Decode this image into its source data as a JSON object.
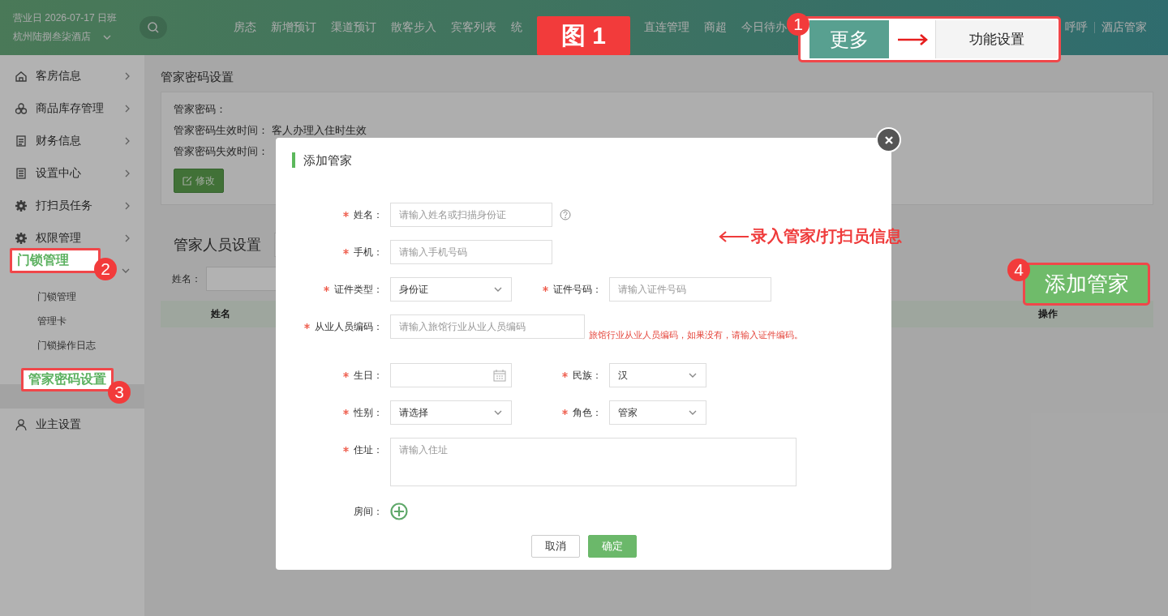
{
  "header": {
    "business_day": "营业日 2026-07-17 日班",
    "hotel": "杭州陆捌叁柒酒店",
    "nav": [
      [
        "房态",
        "新增预订",
        "渠道预订",
        "散客步入",
        "宾客列表",
        "统"
      ],
      [
        "直连管理",
        "商超",
        "今日待办"
      ]
    ],
    "right_links": [
      "呼呼",
      "酒店管家"
    ]
  },
  "sidebar": [
    {
      "label": "客房信息",
      "kind": "group",
      "expanded": false
    },
    {
      "label": "商品库存管理",
      "kind": "group",
      "expanded": false
    },
    {
      "label": "财务信息",
      "kind": "group",
      "expanded": false
    },
    {
      "label": "设置中心",
      "kind": "group",
      "expanded": false
    },
    {
      "label": "打扫员任务",
      "kind": "group",
      "expanded": false
    },
    {
      "label": "权限管理",
      "kind": "group",
      "expanded": false
    },
    {
      "kind": "group",
      "expanded": true,
      "children": [
        {
          "label": "门锁管理",
          "selected": false
        },
        {
          "label": "管理卡",
          "selected": false
        },
        {
          "label": "门锁操作日志",
          "selected": false
        },
        {
          "selected": true
        }
      ]
    },
    {
      "label": "业主设置",
      "kind": "link"
    }
  ],
  "password_panel": {
    "title": "管家密码设置",
    "fields": [
      {
        "label": "管家密码："
      },
      {
        "label": "管家密码生效时间：",
        "value": "客人办理入住时生效"
      },
      {
        "label": "管家密码失效时间："
      }
    ],
    "edit_button": "修改"
  },
  "staff": {
    "title": "管家人员设置",
    "filter_label": "姓名：",
    "columns": [
      "姓名",
      "操作"
    ]
  },
  "dialog": {
    "title": "添加管家",
    "rows": [
      [
        {
          "kind": "input",
          "label": "姓名：",
          "required": true,
          "placeholder": "请输入姓名或扫描身份证",
          "help": true
        }
      ],
      [
        {
          "kind": "input",
          "label": "手机：",
          "required": true,
          "placeholder": "请输入手机号码"
        }
      ],
      [
        {
          "kind": "select",
          "label": "证件类型：",
          "required": true,
          "value": "身份证"
        },
        {
          "kind": "input",
          "label": "证件号码：",
          "required": true,
          "placeholder": "请输入证件号码"
        }
      ],
      [
        {
          "kind": "input",
          "label": "从业人员编码：",
          "required": true,
          "placeholder": "请输入旅馆行业从业人员编码",
          "hint": "旅馆行业从业人员编码，如果没有，请输入证件编码。"
        }
      ],
      [
        {
          "kind": "date",
          "label": "生日：",
          "required": true
        },
        {
          "kind": "select",
          "label": "民族：",
          "required": true,
          "value": "汉"
        }
      ],
      [
        {
          "kind": "select",
          "label": "性别：",
          "required": true,
          "value": "请选择"
        },
        {
          "kind": "select",
          "label": "角色：",
          "required": true,
          "value": "管家"
        }
      ],
      [
        {
          "kind": "textarea",
          "label": "住址：",
          "required": true,
          "placeholder": "请输入住址"
        }
      ],
      [
        {
          "kind": "add",
          "label": "房间：",
          "required": false
        }
      ]
    ],
    "buttons": [
      {
        "label": "取消",
        "kind": "secondary"
      },
      {
        "label": "确定",
        "kind": "primary"
      }
    ]
  },
  "annotations": {
    "figure_label": "图 1",
    "note": "录入管家/打扫员信息",
    "steps": [
      {
        "number": "1",
        "kind": "menu-path",
        "parts": [
          "更多",
          "功能设置"
        ]
      },
      {
        "number": "2",
        "kind": "label",
        "text": "门锁管理"
      },
      {
        "number": "3",
        "kind": "label",
        "text": "管家密码设置"
      },
      {
        "number": "4",
        "kind": "button",
        "text": "添加管家"
      }
    ]
  }
}
